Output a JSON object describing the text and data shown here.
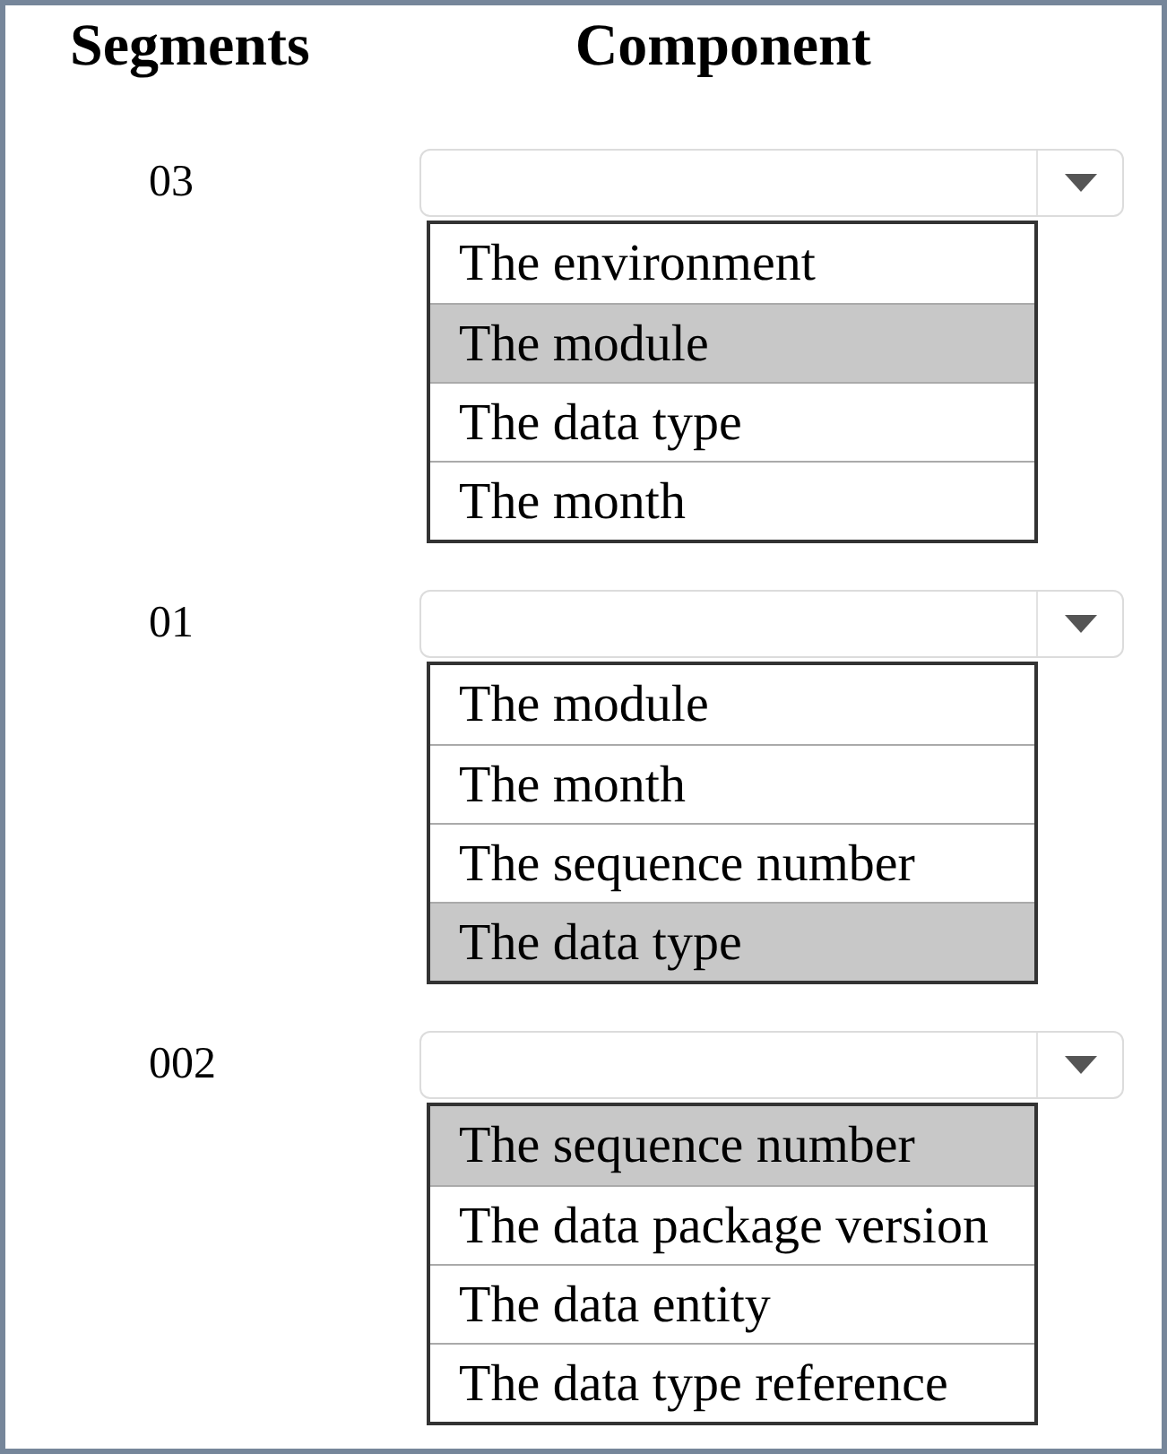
{
  "headers": {
    "segments": "Segments",
    "component": "Component"
  },
  "rows": [
    {
      "segment": "03",
      "options": [
        {
          "label": "The environment",
          "selected": false
        },
        {
          "label": "The module",
          "selected": true
        },
        {
          "label": "The data type",
          "selected": false
        },
        {
          "label": "The month",
          "selected": false
        }
      ]
    },
    {
      "segment": "01",
      "options": [
        {
          "label": "The module",
          "selected": false
        },
        {
          "label": "The month",
          "selected": false
        },
        {
          "label": "The sequence number",
          "selected": false
        },
        {
          "label": "The data type",
          "selected": true
        }
      ]
    },
    {
      "segment": "002",
      "options": [
        {
          "label": "The sequence number",
          "selected": true
        },
        {
          "label": "The data package version",
          "selected": false
        },
        {
          "label": "The data entity",
          "selected": false
        },
        {
          "label": "The data type reference",
          "selected": false
        }
      ]
    }
  ]
}
